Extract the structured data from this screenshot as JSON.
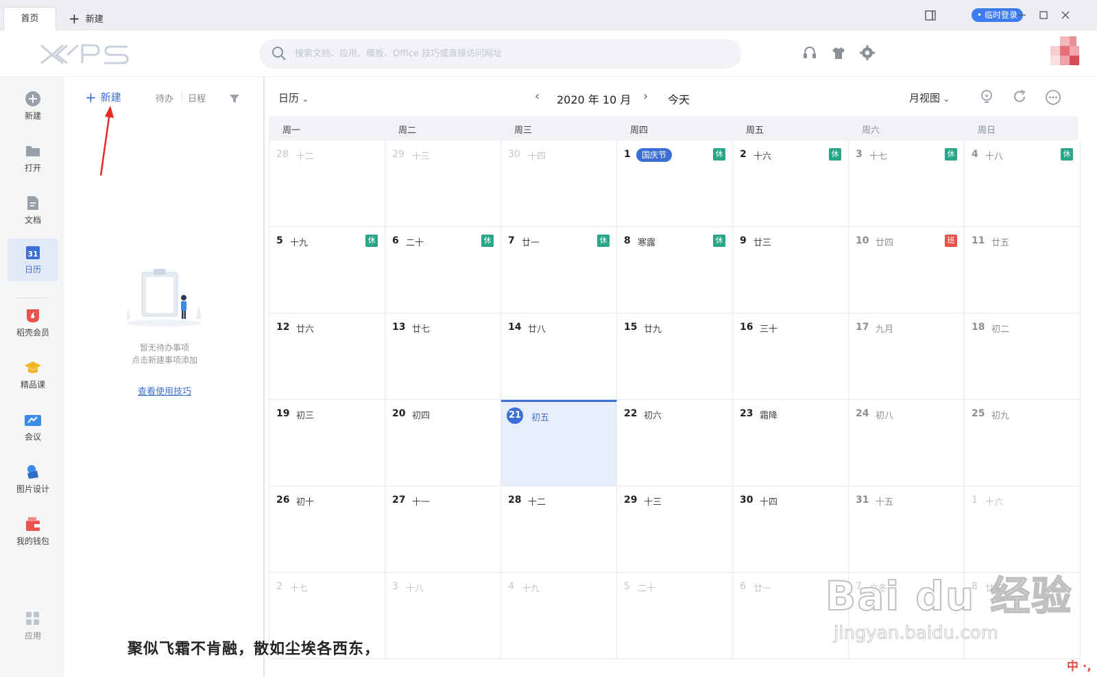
{
  "tabs": {
    "home": "首页",
    "new_tab": "新建"
  },
  "window": {
    "login_badge": "• 临时登录"
  },
  "header": {
    "search_placeholder": "搜索文档、应用、模板、Office 技巧或直接访问网址"
  },
  "sidebar": {
    "items": [
      {
        "label": "新建",
        "icon": "plus-circle-icon"
      },
      {
        "label": "打开",
        "icon": "folder-icon"
      },
      {
        "label": "文档",
        "icon": "document-icon"
      },
      {
        "label": "日历",
        "icon": "calendar-icon",
        "active": true
      },
      {
        "label": "稻壳会员",
        "icon": "docer-icon"
      },
      {
        "label": "精品课",
        "icon": "graduation-cap-icon"
      },
      {
        "label": "会议",
        "icon": "meeting-icon"
      },
      {
        "label": "图片设计",
        "icon": "picture-design-icon"
      },
      {
        "label": "我的钱包",
        "icon": "wallet-icon"
      },
      {
        "label": "应用",
        "icon": "apps-icon"
      }
    ]
  },
  "todo": {
    "new_label": "新建",
    "tab_todo": "待办",
    "tab_schedule": "日程",
    "empty_line1": "暂无待办事项",
    "empty_line2": "点击新建事项添加",
    "tips_link": "查看使用技巧"
  },
  "calendar": {
    "type_dropdown": "日历",
    "month_label": "2020 年 10 月",
    "today_button": "今天",
    "view_dropdown": "月视图",
    "weekdays": [
      "周一",
      "周二",
      "周三",
      "周四",
      "周五",
      "周六",
      "周日"
    ],
    "weeks": [
      [
        {
          "d": "28",
          "l": "十二",
          "o": 1
        },
        {
          "d": "29",
          "l": "十三",
          "o": 1
        },
        {
          "d": "30",
          "l": "十四",
          "o": 1
        },
        {
          "d": "1",
          "l": "",
          "h": "国庆节",
          "b": "休"
        },
        {
          "d": "2",
          "l": "十六",
          "b": "休"
        },
        {
          "d": "3",
          "l": "十七",
          "b": "休"
        },
        {
          "d": "4",
          "l": "十八",
          "b": "休"
        }
      ],
      [
        {
          "d": "5",
          "l": "十九",
          "b": "休"
        },
        {
          "d": "6",
          "l": "二十",
          "b": "休"
        },
        {
          "d": "7",
          "l": "廿一",
          "b": "休"
        },
        {
          "d": "8",
          "l": "寒露",
          "b": "休"
        },
        {
          "d": "9",
          "l": "廿三"
        },
        {
          "d": "10",
          "l": "廿四",
          "w": "班"
        },
        {
          "d": "11",
          "l": "廿五"
        }
      ],
      [
        {
          "d": "12",
          "l": "廿六"
        },
        {
          "d": "13",
          "l": "廿七"
        },
        {
          "d": "14",
          "l": "廿八"
        },
        {
          "d": "15",
          "l": "廿九"
        },
        {
          "d": "16",
          "l": "三十"
        },
        {
          "d": "17",
          "l": "九月"
        },
        {
          "d": "18",
          "l": "初二"
        }
      ],
      [
        {
          "d": "19",
          "l": "初三"
        },
        {
          "d": "20",
          "l": "初四"
        },
        {
          "d": "21",
          "l": "初五",
          "t": 1
        },
        {
          "d": "22",
          "l": "初六"
        },
        {
          "d": "23",
          "l": "霜降"
        },
        {
          "d": "24",
          "l": "初八"
        },
        {
          "d": "25",
          "l": "初九"
        }
      ],
      [
        {
          "d": "26",
          "l": "初十"
        },
        {
          "d": "27",
          "l": "十一"
        },
        {
          "d": "28",
          "l": "十二"
        },
        {
          "d": "29",
          "l": "十三"
        },
        {
          "d": "30",
          "l": "十四"
        },
        {
          "d": "31",
          "l": "十五"
        },
        {
          "d": "1",
          "l": "十六",
          "o": 1
        }
      ],
      [
        {
          "d": "2",
          "l": "十七",
          "o": 1
        },
        {
          "d": "3",
          "l": "十八",
          "o": 1
        },
        {
          "d": "4",
          "l": "十九",
          "o": 1
        },
        {
          "d": "5",
          "l": "二十",
          "o": 1
        },
        {
          "d": "6",
          "l": "廿一",
          "o": 1
        },
        {
          "d": "7",
          "l": "立冬",
          "o": 1
        },
        {
          "d": "8",
          "l": "廿三",
          "o": 1
        }
      ]
    ]
  },
  "overlay": {
    "subtitle": "聚似飞霜不肯融，散如尘埃各西东，",
    "watermark": "Bai du 经验",
    "watermark_url": "jingyan.baidu.com",
    "ime": "中 ·,"
  },
  "colors": {
    "accent": "#3c6fd6",
    "rest": "#29a58a",
    "work": "#e8534b"
  }
}
